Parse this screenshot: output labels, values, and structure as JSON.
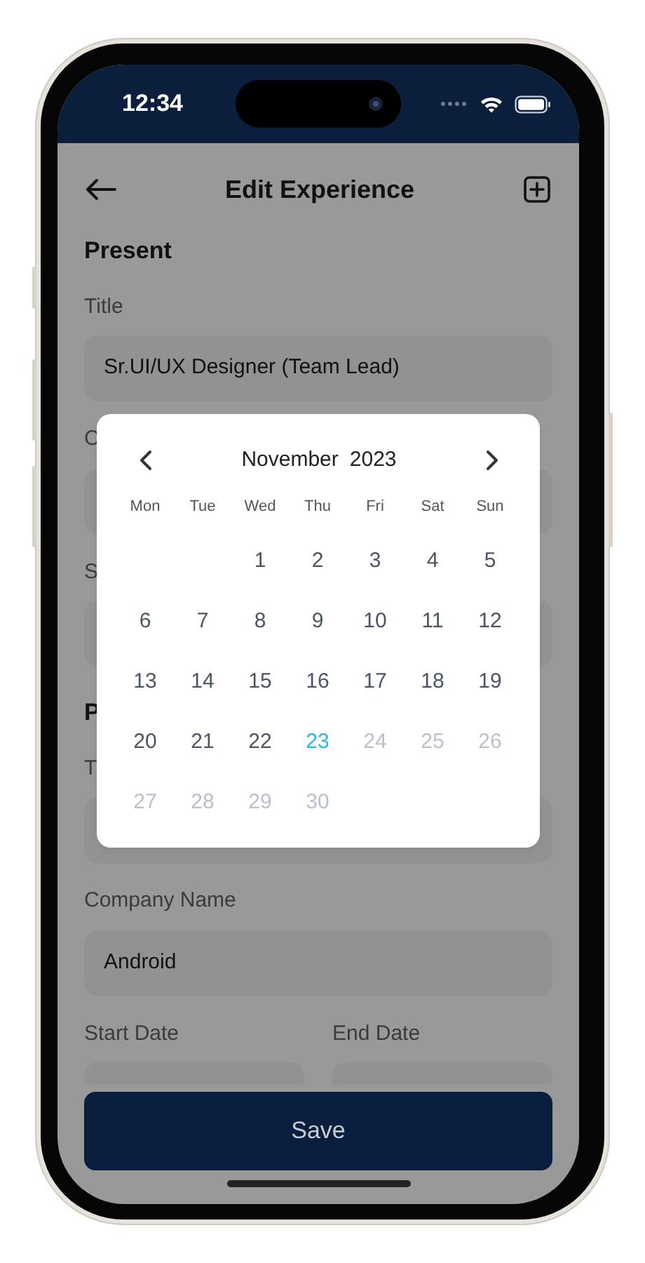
{
  "status_bar": {
    "time": "12:34"
  },
  "header": {
    "title": "Edit Experience"
  },
  "present": {
    "heading": "Present",
    "fields": [
      {
        "label": "Title",
        "value": "Sr.UI/UX Designer (Team Lead)"
      },
      {
        "label": "C"
      },
      {
        "label": "S"
      }
    ]
  },
  "previous": {
    "heading": "P",
    "fields": [
      {
        "label": "T"
      },
      {
        "label": "Company Name",
        "value": "Android"
      }
    ],
    "date_fields": [
      {
        "label": "Start Date"
      },
      {
        "label": "End Date"
      }
    ]
  },
  "calendar": {
    "month": "November",
    "year": "2023",
    "weekdays": [
      "Mon",
      "Tue",
      "Wed",
      "Thu",
      "Fri",
      "Sat",
      "Sun"
    ],
    "weeks": [
      [
        {
          "kind": "blank"
        },
        {
          "kind": "blank"
        },
        {
          "kind": "day",
          "day": "1",
          "selected": false,
          "disabled": false
        },
        {
          "kind": "day",
          "day": "2",
          "selected": false,
          "disabled": false
        },
        {
          "kind": "day",
          "day": "3",
          "selected": false,
          "disabled": false
        },
        {
          "kind": "day",
          "day": "4",
          "selected": false,
          "disabled": false
        },
        {
          "kind": "day",
          "day": "5",
          "selected": false,
          "disabled": false
        }
      ],
      [
        {
          "kind": "day",
          "day": "6",
          "selected": false,
          "disabled": false
        },
        {
          "kind": "day",
          "day": "7",
          "selected": false,
          "disabled": false
        },
        {
          "kind": "day",
          "day": "8",
          "selected": false,
          "disabled": false
        },
        {
          "kind": "day",
          "day": "9",
          "selected": false,
          "disabled": false
        },
        {
          "kind": "day",
          "day": "10",
          "selected": false,
          "disabled": false
        },
        {
          "kind": "day",
          "day": "11",
          "selected": false,
          "disabled": false
        },
        {
          "kind": "day",
          "day": "12",
          "selected": false,
          "disabled": false
        }
      ],
      [
        {
          "kind": "day",
          "day": "13",
          "selected": false,
          "disabled": false
        },
        {
          "kind": "day",
          "day": "14",
          "selected": false,
          "disabled": false
        },
        {
          "kind": "day",
          "day": "15",
          "selected": false,
          "disabled": false
        },
        {
          "kind": "day",
          "day": "16",
          "selected": false,
          "disabled": false
        },
        {
          "kind": "day",
          "day": "17",
          "selected": false,
          "disabled": false
        },
        {
          "kind": "day",
          "day": "18",
          "selected": false,
          "disabled": false
        },
        {
          "kind": "day",
          "day": "19",
          "selected": false,
          "disabled": false
        }
      ],
      [
        {
          "kind": "day",
          "day": "20",
          "selected": false,
          "disabled": false
        },
        {
          "kind": "day",
          "day": "21",
          "selected": false,
          "disabled": false
        },
        {
          "kind": "day",
          "day": "22",
          "selected": false,
          "disabled": false
        },
        {
          "kind": "day",
          "day": "23",
          "selected": true,
          "disabled": false
        },
        {
          "kind": "day",
          "day": "24",
          "selected": false,
          "disabled": true
        },
        {
          "kind": "day",
          "day": "25",
          "selected": false,
          "disabled": true
        },
        {
          "kind": "day",
          "day": "26",
          "selected": false,
          "disabled": true
        }
      ],
      [
        {
          "kind": "day",
          "day": "27",
          "selected": false,
          "disabled": true
        },
        {
          "kind": "day",
          "day": "28",
          "selected": false,
          "disabled": true
        },
        {
          "kind": "day",
          "day": "29",
          "selected": false,
          "disabled": true
        },
        {
          "kind": "day",
          "day": "30",
          "selected": false,
          "disabled": true
        }
      ]
    ]
  },
  "save_button": "Save"
}
